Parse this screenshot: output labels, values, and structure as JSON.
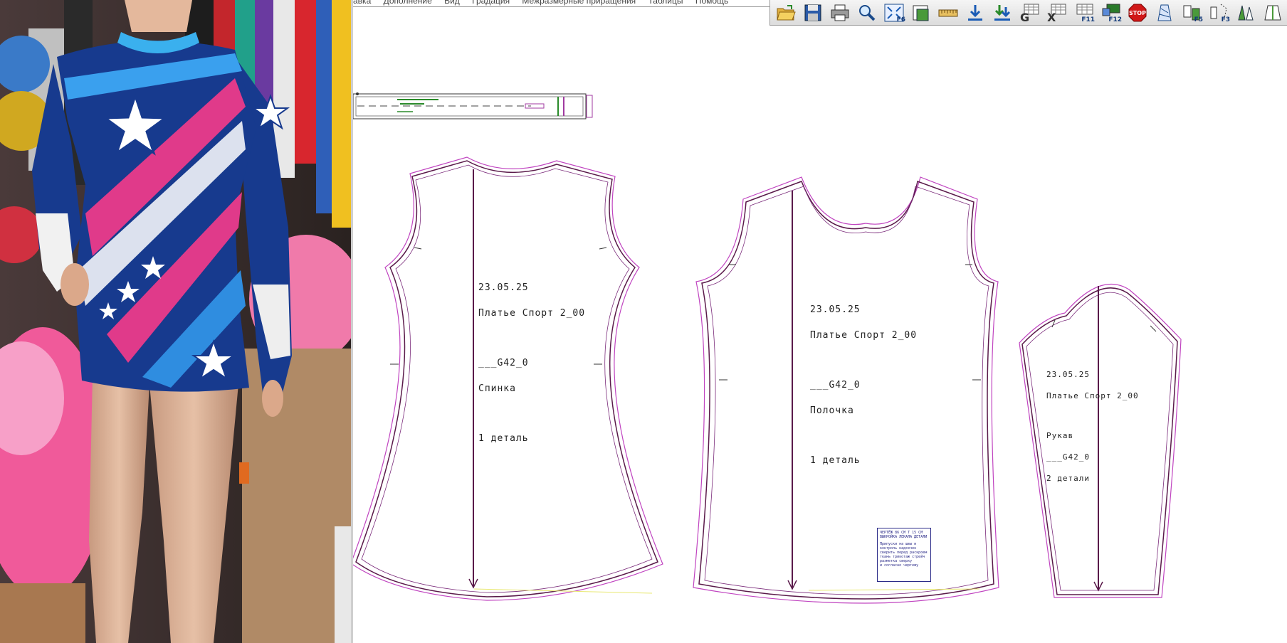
{
  "menu": [
    "авка",
    "Дополнение",
    "Вид",
    "Градация",
    "Межразмерные приращения",
    "Таблицы",
    "Помощь"
  ],
  "toolbar": [
    {
      "icon": "open-folder-icon"
    },
    {
      "icon": "save-disk-icon"
    },
    {
      "icon": "printer-icon"
    },
    {
      "icon": "magnifier-icon"
    },
    {
      "icon": "zoom-fit-icon",
      "label": "F6"
    },
    {
      "icon": "page-view-icon"
    },
    {
      "icon": "ruler-icon"
    },
    {
      "icon": "download-arrow-icon"
    },
    {
      "icon": "download-double-icon"
    },
    {
      "icon": "grading-g-icon"
    },
    {
      "icon": "table-x-icon"
    },
    {
      "icon": "table-f11-icon",
      "label": "F11"
    },
    {
      "icon": "table-f12-icon",
      "label": "F12"
    },
    {
      "icon": "stop-sign-icon",
      "label": "STOP"
    },
    {
      "icon": "pattern-piece-icon"
    },
    {
      "icon": "pieces-f5-icon",
      "label": "F5"
    },
    {
      "icon": "pieces-f3-icon",
      "label": "F3"
    },
    {
      "icon": "measure-icon"
    },
    {
      "icon": "sleeve-icon"
    }
  ],
  "pieces": {
    "back": {
      "date": "23.05.25",
      "model": "Платье Спорт 2_00",
      "size": "___G42_0",
      "name": "Спинка",
      "qty": "1 деталь"
    },
    "front": {
      "date": "23.05.25",
      "model": "Платье Спорт 2_00",
      "size": "___G42_0",
      "name": "Полочка",
      "qty": "1 деталь"
    },
    "sleeve": {
      "date": "23.05.25",
      "model": "Платье Спорт 2_00",
      "name": "Рукав",
      "size": "___G42_0",
      "qty": "2 детали"
    }
  },
  "stamp": {
    "line1": "ЧЕРТЁЖ 86 СМ Т 15 СМ",
    "line2": "ВЫКРОЙКА ЛЕКАЛА ДЕТАЛИ",
    "line3": "Припуски на швы и",
    "line4": "контроль надсечек",
    "line5": "сверить перед раскроем",
    "line6": "ткань трикотаж стрейч",
    "line7": "разметка сверху",
    "line8": "и согласно чертежу"
  },
  "colors": {
    "outline": "#5a1a4a",
    "seam": "#c044c0",
    "toolbar_icon": "#1a5bb5",
    "stop": "#d01818"
  }
}
